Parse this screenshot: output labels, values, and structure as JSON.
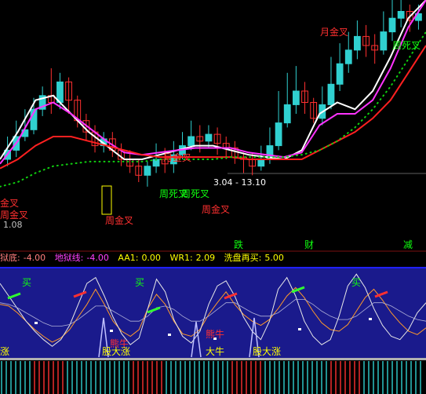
{
  "status_bar": {
    "items": [
      {
        "label": "狱底:",
        "value": "-4.00",
        "color": "#ff7f7f"
      },
      {
        "label": "地狱线:",
        "value": "-4.00",
        "color": "#ff40ff"
      },
      {
        "label": "AA1:",
        "value": "0.00",
        "color": "#ffff00"
      },
      {
        "label": "WR1:",
        "value": "2.09",
        "color": "#ffff00"
      },
      {
        "label": "洗盘再买:",
        "value": "5.00",
        "color": "#ffff00"
      }
    ]
  },
  "colors": {
    "up_candle": "#30d0d0",
    "down_candle": "#ff3030",
    "ma_white": "#ffffff",
    "ma_magenta": "#ff33ff",
    "ma_red": "#ff2020",
    "dotted_ma": "#10d010",
    "indicator_bg": "#1a1a8c",
    "bottom_red_bar": "#ff3030",
    "bottom_cyan_bar": "#30d0d0"
  },
  "chart_data": [
    {
      "type": "candlestick",
      "panel": "price",
      "title": "",
      "xlabel": "",
      "ylabel": "",
      "ylim": [
        0,
        100
      ],
      "grid": false,
      "candles": [
        {
          "o": 30,
          "c": 34,
          "h": 40,
          "l": 27
        },
        {
          "o": 34,
          "c": 40,
          "h": 47,
          "l": 31
        },
        {
          "o": 40,
          "c": 43,
          "h": 52,
          "l": 38
        },
        {
          "o": 43,
          "c": 52,
          "h": 57,
          "l": 41
        },
        {
          "o": 52,
          "c": 58,
          "h": 62,
          "l": 49
        },
        {
          "o": 58,
          "c": 55,
          "h": 70,
          "l": 50
        },
        {
          "o": 55,
          "c": 64,
          "h": 68,
          "l": 52
        },
        {
          "o": 64,
          "c": 56,
          "h": 66,
          "l": 50
        },
        {
          "o": 56,
          "c": 47,
          "h": 58,
          "l": 44
        },
        {
          "o": 47,
          "c": 42,
          "h": 50,
          "l": 38
        },
        {
          "o": 42,
          "c": 36,
          "h": 45,
          "l": 33
        },
        {
          "o": 36,
          "c": 39,
          "h": 42,
          "l": 33
        },
        {
          "o": 39,
          "c": 34,
          "h": 42,
          "l": 31
        },
        {
          "o": 34,
          "c": 30,
          "h": 37,
          "l": 27
        },
        {
          "o": 30,
          "c": 27,
          "h": 34,
          "l": 24
        },
        {
          "o": 27,
          "c": 23,
          "h": 30,
          "l": 20
        },
        {
          "o": 23,
          "c": 27,
          "h": 29,
          "l": 18
        },
        {
          "o": 27,
          "c": 30,
          "h": 37,
          "l": 24
        },
        {
          "o": 30,
          "c": 28,
          "h": 35,
          "l": 24
        },
        {
          "o": 28,
          "c": 32,
          "h": 38,
          "l": 24
        },
        {
          "o": 32,
          "c": 36,
          "h": 42,
          "l": 30
        },
        {
          "o": 36,
          "c": 40,
          "h": 47,
          "l": 34
        },
        {
          "o": 40,
          "c": 38,
          "h": 45,
          "l": 33
        },
        {
          "o": 38,
          "c": 41,
          "h": 45,
          "l": 35
        },
        {
          "o": 41,
          "c": 37,
          "h": 44,
          "l": 32
        },
        {
          "o": 37,
          "c": 35,
          "h": 40,
          "l": 30
        },
        {
          "o": 35,
          "c": 31,
          "h": 38,
          "l": 28
        },
        {
          "o": 31,
          "c": 30,
          "h": 33,
          "l": 24
        },
        {
          "o": 30,
          "c": 27,
          "h": 33,
          "l": 23
        },
        {
          "o": 27,
          "c": 30,
          "h": 36,
          "l": 25
        },
        {
          "o": 30,
          "c": 36,
          "h": 44,
          "l": 28
        },
        {
          "o": 36,
          "c": 46,
          "h": 60,
          "l": 34
        },
        {
          "o": 46,
          "c": 54,
          "h": 68,
          "l": 44
        },
        {
          "o": 54,
          "c": 60,
          "h": 71,
          "l": 50
        },
        {
          "o": 60,
          "c": 55,
          "h": 64,
          "l": 50
        },
        {
          "o": 55,
          "c": 48,
          "h": 57,
          "l": 46
        },
        {
          "o": 48,
          "c": 54,
          "h": 62,
          "l": 45
        },
        {
          "o": 54,
          "c": 63,
          "h": 75,
          "l": 52
        },
        {
          "o": 63,
          "c": 72,
          "h": 81,
          "l": 60
        },
        {
          "o": 72,
          "c": 78,
          "h": 86,
          "l": 68
        },
        {
          "o": 78,
          "c": 84,
          "h": 91,
          "l": 74
        },
        {
          "o": 84,
          "c": 80,
          "h": 89,
          "l": 75
        },
        {
          "o": 80,
          "c": 78,
          "h": 85,
          "l": 72
        },
        {
          "o": 78,
          "c": 86,
          "h": 95,
          "l": 76
        },
        {
          "o": 86,
          "c": 92,
          "h": 100,
          "l": 82
        },
        {
          "o": 92,
          "c": 95,
          "h": 100,
          "l": 88
        },
        {
          "o": 95,
          "c": 91,
          "h": 98,
          "l": 86
        },
        {
          "o": 91,
          "c": 94,
          "h": 98,
          "l": 87
        }
      ],
      "series": [
        {
          "values": [
            30,
            42,
            56,
            58,
            50,
            42,
            36,
            30,
            30,
            32,
            34,
            36,
            36,
            34,
            32,
            31,
            30,
            34,
            50,
            55,
            52,
            60,
            75,
            92,
            100
          ]
        },
        {
          "values": [
            28,
            38,
            52,
            55,
            50,
            44,
            38,
            33,
            32,
            33,
            34,
            35,
            35,
            35,
            33,
            32,
            31,
            33,
            45,
            50,
            50,
            56,
            70,
            88,
            100
          ]
        },
        {
          "values": [
            26,
            30,
            36,
            40,
            40,
            38,
            36,
            34,
            32,
            31,
            31,
            31,
            31,
            31,
            30,
            30,
            30,
            30,
            34,
            38,
            42,
            48,
            56,
            68,
            80
          ]
        },
        {
          "values": [
            18,
            20,
            24,
            27,
            28,
            29,
            29,
            29,
            29,
            30,
            30,
            30,
            30,
            31,
            31,
            31,
            31,
            32,
            34,
            38,
            44,
            52,
            62,
            74,
            86
          ]
        }
      ],
      "annotations": [
        {
          "text": "金叉",
          "color": "#ff3030"
        },
        {
          "text": "周金叉",
          "color": "#ff3030"
        },
        {
          "text": "1.08",
          "color": "#c0c0c0"
        },
        {
          "text": "月金叉",
          "color": "#ff3030"
        },
        {
          "text": "周金叉",
          "color": "#ff3030"
        },
        {
          "text": "周死叉",
          "color": "#10ff10"
        },
        {
          "text": "周金叉",
          "color": "#ff3030"
        },
        {
          "text": "周死叉",
          "color": "#10ff10"
        },
        {
          "text": "3.04 - 13.10",
          "color": "#ffffff"
        },
        {
          "text": "月金叉",
          "color": "#ff3030"
        },
        {
          "text": "周死叉",
          "color": "#10ff10"
        },
        {
          "text": "跌",
          "color": "#10ff10"
        },
        {
          "text": "财",
          "color": "#10ff10"
        },
        {
          "text": "减",
          "color": "#10ff10"
        }
      ]
    },
    {
      "type": "line",
      "panel": "indicator",
      "title": "",
      "ylim": [
        0,
        100
      ],
      "grid": false,
      "series": [
        {
          "values": [
            60,
            58,
            50,
            40,
            30,
            22,
            15,
            20,
            30,
            45,
            60,
            78,
            60,
            40,
            28,
            22,
            30,
            55,
            72,
            60,
            40,
            25,
            22,
            30,
            48,
            62,
            75,
            60,
            48,
            40,
            35,
            42,
            55,
            70,
            80,
            68,
            52,
            38,
            30,
            28,
            36,
            52,
            68,
            78,
            65,
            50,
            38,
            28,
            24,
            32
          ]
        },
        {
          "values": [
            85,
            70,
            55,
            40,
            28,
            18,
            10,
            18,
            35,
            60,
            85,
            92,
            70,
            45,
            25,
            12,
            20,
            55,
            90,
            75,
            42,
            22,
            14,
            28,
            60,
            82,
            88,
            70,
            45,
            28,
            18,
            40,
            78,
            92,
            70,
            40,
            22,
            12,
            18,
            46,
            82,
            96,
            80,
            55,
            35,
            22,
            18,
            30,
            50,
            62
          ]
        },
        {
          "values": [
            62,
            60,
            56,
            50,
            44,
            38,
            34,
            34,
            36,
            42,
            50,
            58,
            58,
            52,
            46,
            40,
            40,
            46,
            56,
            58,
            54,
            46,
            40,
            40,
            46,
            54,
            62,
            62,
            56,
            50,
            46,
            46,
            50,
            58,
            66,
            66,
            60,
            52,
            46,
            42,
            42,
            46,
            54,
            62,
            62,
            58,
            52,
            46,
            42,
            40
          ]
        }
      ],
      "annotations": [
        {
          "text": "买",
          "color": "#10ff10"
        },
        {
          "text": "买",
          "color": "#10ff10"
        },
        {
          "text": "买",
          "color": "#10ff10"
        },
        {
          "text": "涨",
          "color": "#ffff00"
        },
        {
          "text": "熊牛",
          "color": "#ff3030"
        },
        {
          "text": "股大涨",
          "color": "#ffff00"
        },
        {
          "text": "熊牛",
          "color": "#ff3030"
        },
        {
          "text": "大牛",
          "color": "#ffff00"
        },
        {
          "text": "股大涨",
          "color": "#ffff00"
        }
      ]
    }
  ]
}
